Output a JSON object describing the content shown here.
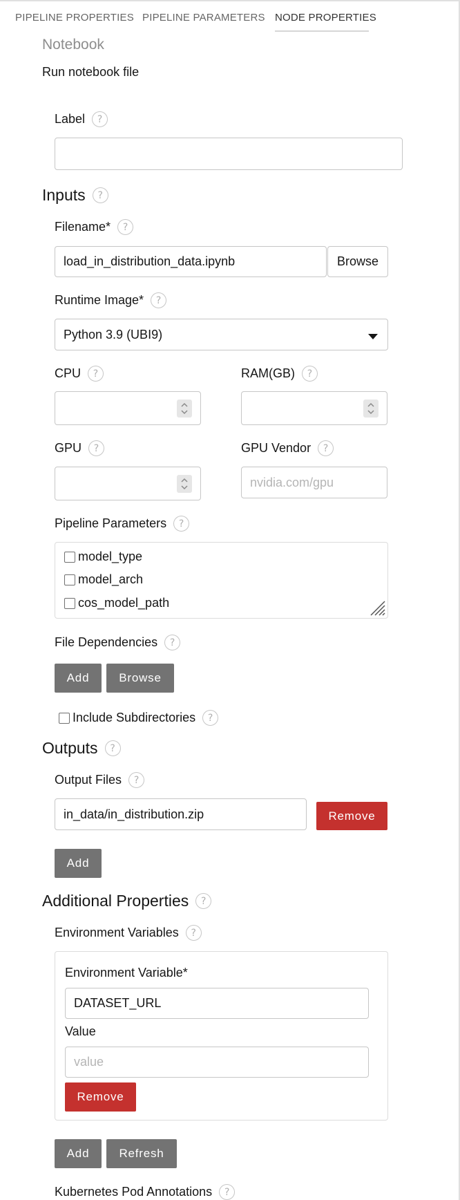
{
  "tabs": [
    {
      "label": "PIPELINE PROPERTIES"
    },
    {
      "label": "PIPELINE PARAMETERS"
    },
    {
      "label": "NODE PROPERTIES"
    }
  ],
  "node": {
    "title": "Notebook",
    "description": "Run notebook file"
  },
  "help_glyph": "?",
  "label_field": {
    "label": "Label",
    "value": ""
  },
  "inputs": {
    "section_title": "Inputs",
    "filename": {
      "label": "Filename*",
      "value": "load_in_distribution_data.ipynb",
      "browse_label": "Browse"
    },
    "runtime_image": {
      "label": "Runtime Image*",
      "selected": "Python 3.9 (UBI9)"
    },
    "cpu": {
      "label": "CPU",
      "value": ""
    },
    "ram": {
      "label": "RAM(GB)",
      "value": ""
    },
    "gpu": {
      "label": "GPU",
      "value": ""
    },
    "gpu_vendor": {
      "label": "GPU Vendor",
      "placeholder": "nvidia.com/gpu"
    },
    "pipeline_parameters": {
      "label": "Pipeline Parameters",
      "items": [
        {
          "name": "model_type",
          "checked": false
        },
        {
          "name": "model_arch",
          "checked": false
        },
        {
          "name": "cos_model_path",
          "checked": false
        }
      ]
    },
    "file_dependencies": {
      "label": "File Dependencies",
      "add_label": "Add",
      "browse_label": "Browse"
    },
    "include_subdirectories": {
      "label": "Include Subdirectories",
      "checked": false
    }
  },
  "outputs": {
    "section_title": "Outputs",
    "output_files": {
      "label": "Output Files",
      "items": [
        {
          "value": "in_data/in_distribution.zip",
          "remove_label": "Remove"
        }
      ],
      "add_label": "Add"
    }
  },
  "additional": {
    "section_title": "Additional Properties",
    "env_vars": {
      "label": "Environment Variables",
      "entries": [
        {
          "name_label": "Environment Variable*",
          "name_value": "DATASET_URL",
          "value_label": "Value",
          "value_placeholder": "value",
          "remove_label": "Remove"
        }
      ],
      "add_label": "Add",
      "refresh_label": "Refresh"
    },
    "k8s_annotations": {
      "label": "Kubernetes Pod Annotations"
    }
  },
  "colors": {
    "remove_button": "#c4312e",
    "gray_button": "#737373",
    "border": "#c6c6c6"
  }
}
